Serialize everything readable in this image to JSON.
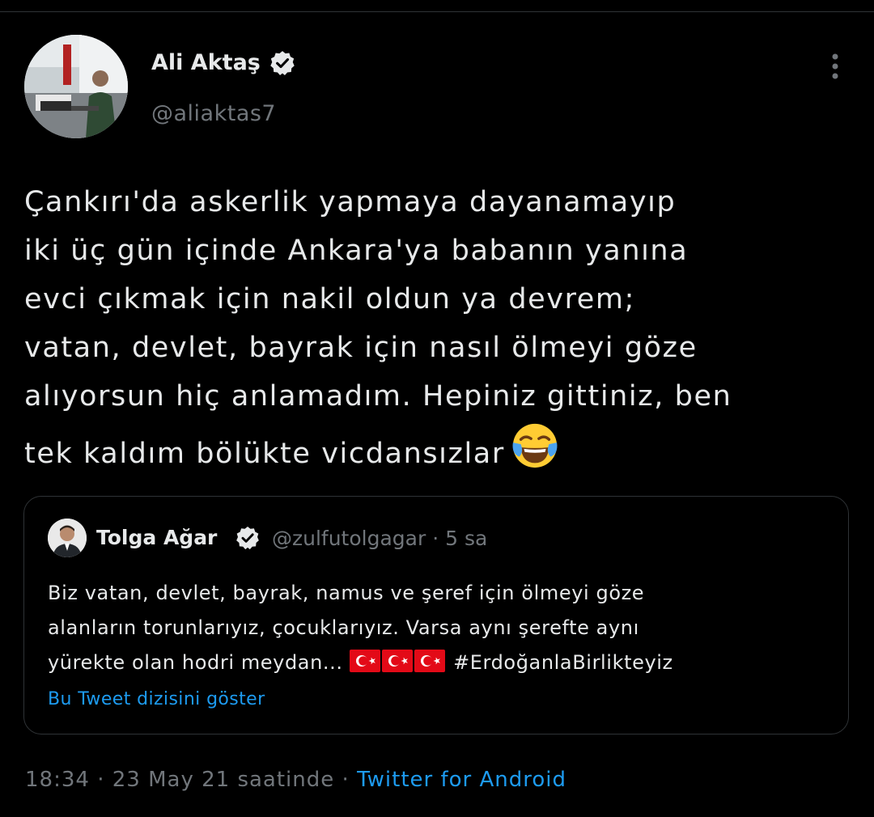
{
  "author": {
    "name": "Ali Aktaş",
    "handle": "@aliaktas7",
    "verified": true,
    "avatar_icon": "profile-photo"
  },
  "tweet": {
    "lines": [
      "Çankırı'da askerlik yapmaya dayanamayıp",
      "iki üç gün içinde Ankara'ya babanın yanına",
      "evci çıkmak için nakil oldun ya devrem;",
      "vatan, devlet, bayrak için nasıl ölmeyi göze",
      "alıyorsun hiç anlamadım. Hepiniz gittiniz, ben",
      "tek kaldım bölükte vicdansızlar"
    ],
    "emoji": "face-with-tears-of-joy-icon"
  },
  "quoted": {
    "name": "Tolga Ağar",
    "handle": "@zulfutolgagar",
    "separator": "·",
    "time": "5 sa",
    "verified": true,
    "lines": [
      "Biz vatan, devlet, bayrak, namus ve şeref için ölmeyi göze",
      "alanların torunlarıyız, çocuklarıyız. Varsa aynı şerefte aynı",
      "yürekte olan hodri meydan..."
    ],
    "hashtag": "#ErdoğanlaBirlikteyiz",
    "flags": [
      "turkey-flag-icon",
      "turkey-flag-icon",
      "turkey-flag-icon"
    ],
    "show_thread": "Bu Tweet dizisini göster"
  },
  "footer": {
    "time": "18:34",
    "sep1": "·",
    "date": "23 May 21 saatinde",
    "sep2": "·",
    "source": "Twitter for Android"
  },
  "colors": {
    "background": "#000000",
    "text": "#e7e9ea",
    "secondary": "#71767b",
    "accent": "#1d9bf0",
    "border": "#2f3336",
    "flag_red": "#e30a17"
  }
}
